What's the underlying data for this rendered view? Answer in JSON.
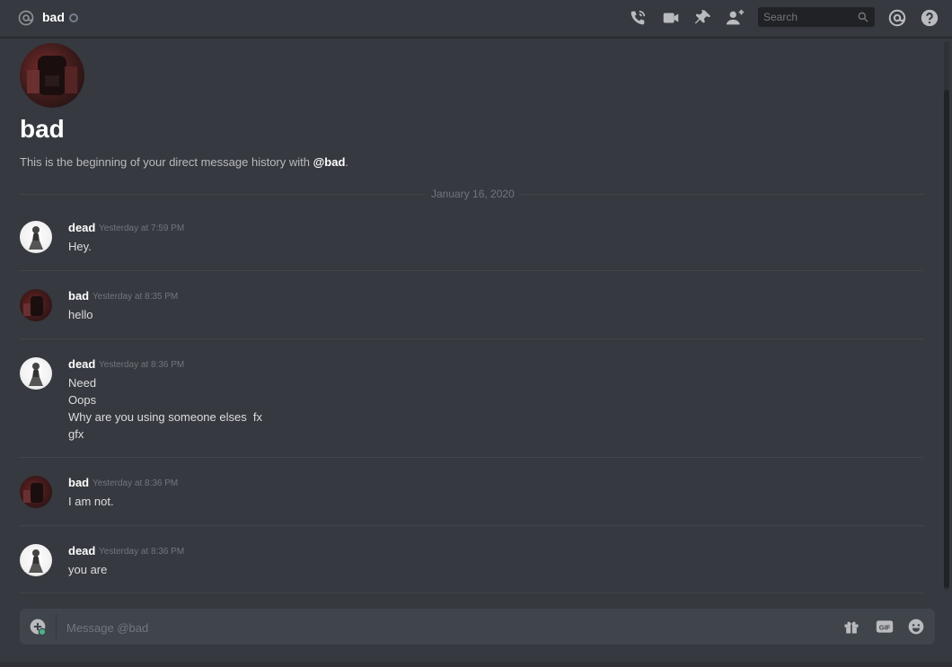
{
  "header": {
    "channel_name": "bad",
    "search_placeholder": "Search"
  },
  "intro": {
    "title": "bad",
    "description_prefix": "This is the beginning of your direct message history with ",
    "description_user": "@bad",
    "description_suffix": "."
  },
  "date_divider": "January 16, 2020",
  "messages": [
    {
      "author": "dead",
      "timestamp": "Yesterday at 7:59 PM",
      "lines": [
        "Hey."
      ]
    },
    {
      "author": "bad",
      "timestamp": "Yesterday at 8:35 PM",
      "lines": [
        "hello"
      ]
    },
    {
      "author": "dead",
      "timestamp": "Yesterday at 8:36 PM",
      "lines": [
        "Need",
        "Oops",
        "Why are you using someone elses  fx",
        "gfx"
      ]
    },
    {
      "author": "bad",
      "timestamp": "Yesterday at 8:36 PM",
      "lines": [
        "I am not."
      ]
    },
    {
      "author": "dead",
      "timestamp": "Yesterday at 8:36 PM",
      "lines": [
        "you are"
      ]
    }
  ],
  "composer": {
    "placeholder": "Message @bad",
    "gif_label": "GIF"
  },
  "icons": {
    "header": [
      "at-sign-icon",
      "call-icon",
      "video-icon",
      "pin-icon",
      "add-friend-icon",
      "search-icon",
      "mentions-icon",
      "help-icon"
    ],
    "composer": [
      "upload-plus-icon",
      "gift-icon",
      "gif-icon",
      "emoji-icon"
    ]
  },
  "colors": {
    "background": "#36393f",
    "composer_bg": "#40444b",
    "muted_text": "#72767d",
    "online_green": "#43b581"
  }
}
